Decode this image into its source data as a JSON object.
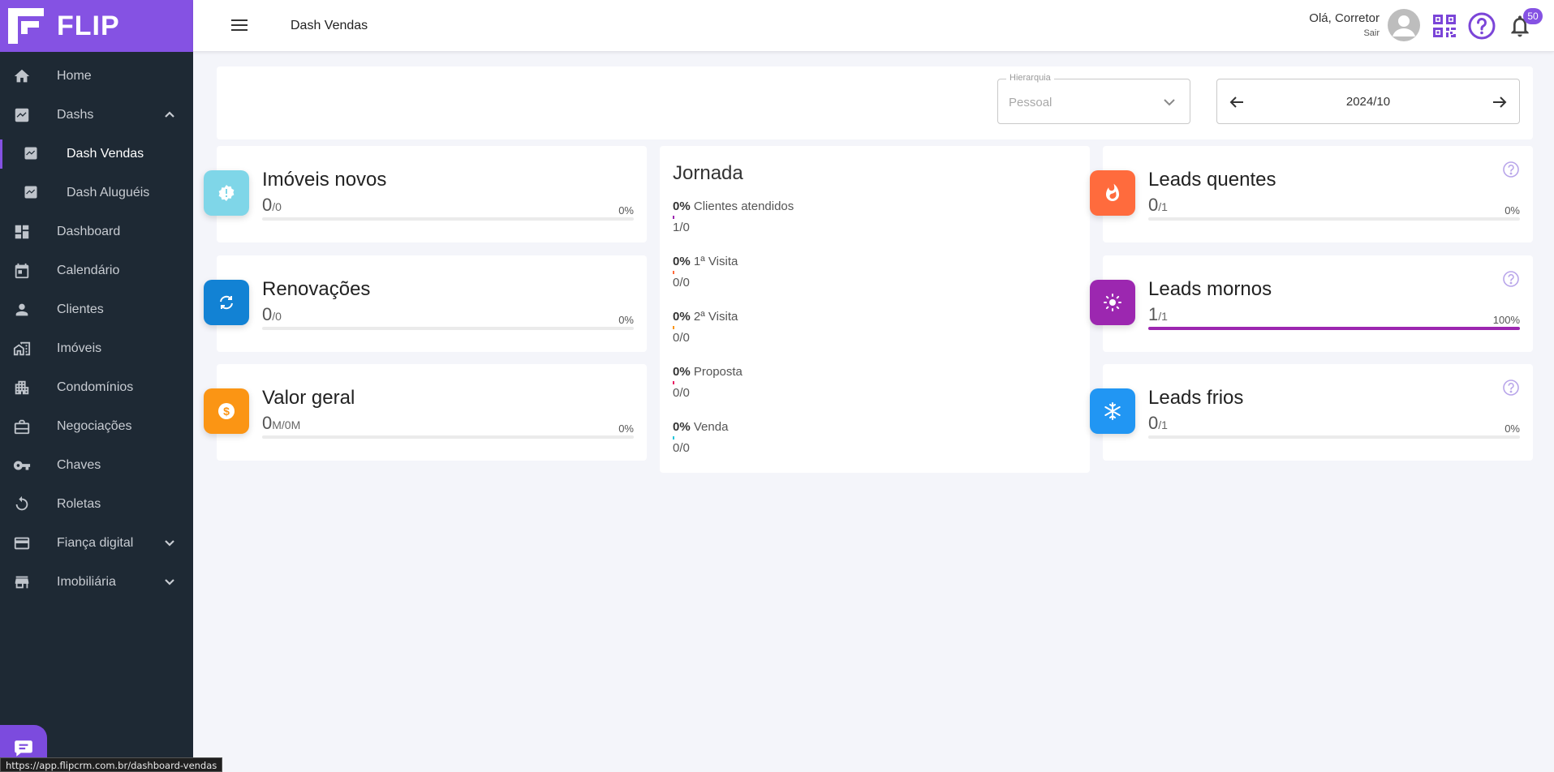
{
  "app": {
    "logo": "FLIP",
    "brand_color": "#8552e3"
  },
  "sidebar": {
    "items": [
      {
        "label": "Home",
        "icon": "home-icon"
      },
      {
        "label": "Dashs",
        "icon": "chart-icon",
        "expanded": true
      },
      {
        "label": "Dash Vendas",
        "icon": "chart-icon",
        "sub": true,
        "active": true
      },
      {
        "label": "Dash Aluguéis",
        "icon": "chart-icon",
        "sub": true
      },
      {
        "label": "Dashboard",
        "icon": "dashboard-icon"
      },
      {
        "label": "Calendário",
        "icon": "calendar-icon"
      },
      {
        "label": "Clientes",
        "icon": "person-icon"
      },
      {
        "label": "Imóveis",
        "icon": "buildings-icon"
      },
      {
        "label": "Condomínios",
        "icon": "apartment-icon"
      },
      {
        "label": "Negociações",
        "icon": "briefcase-icon"
      },
      {
        "label": "Chaves",
        "icon": "key-icon"
      },
      {
        "label": "Roletas",
        "icon": "roulette-icon"
      },
      {
        "label": "Fiança digital",
        "icon": "card-icon",
        "expandable": true
      },
      {
        "label": "Imobiliária",
        "icon": "store-icon",
        "expandable": true
      }
    ]
  },
  "status_url": "https://app.flipcrm.com.br/dashboard-vendas",
  "header": {
    "title": "Dash Vendas",
    "greeting": "Olá, Corretor",
    "logout": "Sair",
    "notifications": "50"
  },
  "filters": {
    "hierarchy_label": "Hierarquia",
    "hierarchy_value": "Pessoal",
    "period": "2024/10"
  },
  "cards": {
    "imoveis": {
      "title": "Imóveis novos",
      "value": "0",
      "sub": "/0",
      "pct": "0%",
      "fill": 0,
      "color": "#7fd6e8"
    },
    "renovacoes": {
      "title": "Renovações",
      "value": "0",
      "sub": "/0",
      "pct": "0%",
      "fill": 0,
      "color": "#1282d4"
    },
    "valor": {
      "title": "Valor geral",
      "value": "0",
      "sub": "M/0M",
      "pct": "0%",
      "fill": 0,
      "color": "#fb9514"
    },
    "quentes": {
      "title": "Leads quentes",
      "value": "0",
      "sub": "/1",
      "pct": "0%",
      "fill": 0,
      "color": "#ff6b3d"
    },
    "mornos": {
      "title": "Leads mornos",
      "value": "1",
      "sub": "/1",
      "pct": "100%",
      "fill": 1,
      "color": "#9c27b0"
    },
    "frios": {
      "title": "Leads frios",
      "value": "0",
      "sub": "/1",
      "pct": "0%",
      "fill": 0,
      "color": "#2196f3"
    }
  },
  "jornada": {
    "title": "Jornada",
    "steps": [
      {
        "pct": "0%",
        "label": "Clientes atendidos",
        "value": "1/0",
        "color": "#9c27b0"
      },
      {
        "pct": "0%",
        "label": "1ª Visita",
        "value": "0/0",
        "color": "#ff6b3d"
      },
      {
        "pct": "0%",
        "label": "2ª Visita",
        "value": "0/0",
        "color": "#fb9514"
      },
      {
        "pct": "0%",
        "label": "Proposta",
        "value": "0/0",
        "color": "#e91e63"
      },
      {
        "pct": "0%",
        "label": "Venda",
        "value": "0/0",
        "color": "#26c6da"
      }
    ]
  }
}
